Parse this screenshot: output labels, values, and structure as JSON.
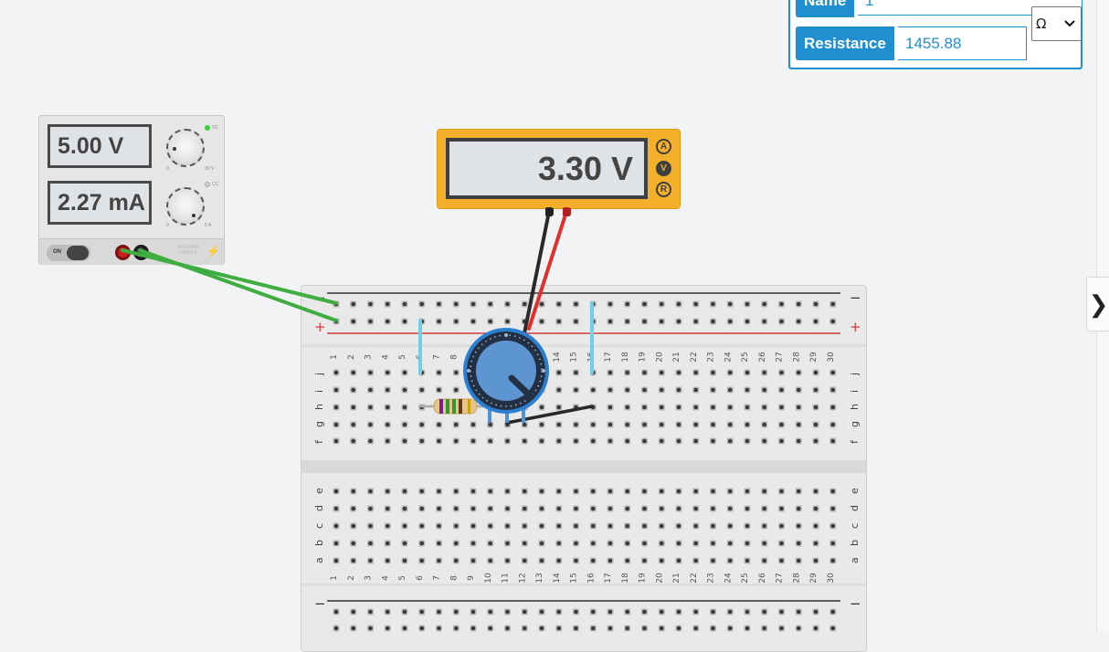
{
  "inspector": {
    "name_label": "Name",
    "name_value": "1",
    "resistance_label": "Resistance",
    "resistance_value": "1455.88",
    "unit_selected": "Ω"
  },
  "power_supply": {
    "voltage_display": "5.00 V",
    "current_display": "2.27 mA",
    "voltage_knob_min": "0",
    "voltage_knob_max": "30 V",
    "current_knob_min": "0",
    "current_knob_max": "5 A",
    "cv_indicator": "VC",
    "cc_indicator": "CC",
    "power_switch_label": "ON",
    "brand_text": "VOLTAGE SUPPLY"
  },
  "multimeter": {
    "display": "3.30 V",
    "modes": [
      "A",
      "V",
      "R"
    ],
    "active_mode": "V"
  },
  "breadboard": {
    "columns_top": [
      "1",
      "2",
      "3",
      "4",
      "5",
      "6",
      "7",
      "8",
      "9",
      "10",
      "11",
      "12",
      "13",
      "14",
      "15",
      "16",
      "17",
      "18",
      "19",
      "20",
      "21",
      "22",
      "23",
      "24",
      "25",
      "26",
      "27",
      "28",
      "29",
      "30"
    ],
    "rows_top": [
      "j",
      "i",
      "h",
      "g",
      "f"
    ],
    "rows_bottom": [
      "e",
      "d",
      "c",
      "b",
      "a"
    ],
    "rail_minus": "−",
    "rail_plus": "+"
  },
  "colors": {
    "accent": "#1f8fcf",
    "multimeter_body": "#f3b02a",
    "wire_green": "#3fad3f",
    "wire_red": "#e0302b",
    "wire_black": "#2a2a2a",
    "jumper_blue": "#6fcfe6",
    "pot_blue": "#4f93d6",
    "rail_red": "#d43a3a"
  },
  "icons": {
    "expand": "❯",
    "select_chevron": "chevron-down-icon",
    "lightning": "lightning-icon"
  }
}
